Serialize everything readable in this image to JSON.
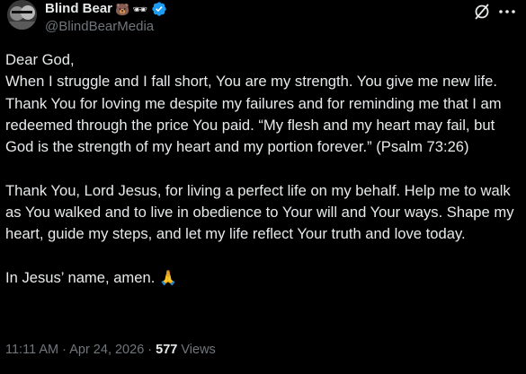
{
  "tweet": {
    "author": {
      "display_name": "Blind Bear",
      "name_emojis": [
        "🐻",
        "🕶"
      ],
      "handle": "@BlindBearMedia",
      "verified": true,
      "avatar_icon": "avatar-image"
    },
    "actions": {
      "grok_icon": "grok-slash-circle-icon",
      "more_icon": "more-dots-icon"
    },
    "body": {
      "paragraph_1": "Dear God,\nWhen I struggle and I fall short, You are my strength. You give me new life. Thank You for loving me despite my failures and for reminding me that I am redeemed through the price You paid. “My flesh and my heart may fail, but God is the strength of my heart and my portion forever.” (Psalm 73:26)",
      "paragraph_2": "Thank You, Lord Jesus, for living a perfect life on my behalf. Help me to walk as You walked and to live in obedience to Your will and Your ways. Shape my heart, guide my steps, and let my life reflect Your truth and love today.",
      "paragraph_3_text": "In Jesus’ name, amen. ",
      "paragraph_3_emoji": "🙏"
    },
    "meta": {
      "time": "11:11 AM",
      "separator": " · ",
      "date": "Apr 24, 2026",
      "separator2": " · ",
      "views_count": "577",
      "views_label": " Views"
    },
    "colors": {
      "background": "#000000",
      "text": "#e7e9ea",
      "secondary_text": "#71767b",
      "verified_blue": "#1d9bf0"
    }
  }
}
